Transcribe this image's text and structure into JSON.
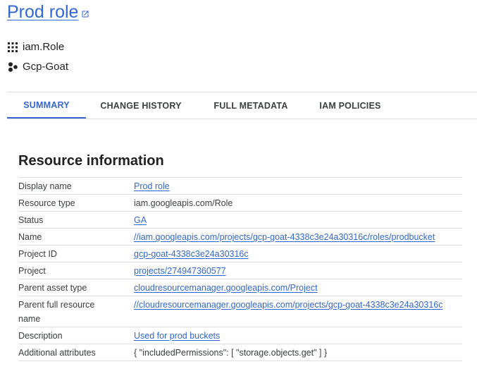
{
  "header": {
    "title": "Prod role",
    "asset_type": "iam.Role",
    "project": "Gcp-Goat"
  },
  "tabs": [
    {
      "label": "SUMMARY",
      "active": true
    },
    {
      "label": "CHANGE HISTORY",
      "active": false
    },
    {
      "label": "FULL METADATA",
      "active": false
    },
    {
      "label": "IAM POLICIES",
      "active": false
    }
  ],
  "resource_info": {
    "title": "Resource information",
    "rows": [
      {
        "key": "Display name",
        "value": "Prod role",
        "link": true
      },
      {
        "key": "Resource type",
        "value": "iam.googleapis.com/Role",
        "link": false
      },
      {
        "key": "Status",
        "value": "GA",
        "link": true
      },
      {
        "key": "Name",
        "value": "//iam.googleapis.com/projects/gcp-goat-4338c3e24a30316c/roles/prodbucket",
        "link": true
      },
      {
        "key": "Project ID",
        "value": "gcp-goat-4338c3e24a30316c",
        "link": true
      },
      {
        "key": "Project",
        "value": "projects/274947360577",
        "link": true
      },
      {
        "key": "Parent asset type",
        "value": "cloudresourcemanager.googleapis.com/Project",
        "link": true
      },
      {
        "key_line1": "Parent full resource",
        "key_line2": "name",
        "value": "//cloudresourcemanager.googleapis.com/projects/gcp-goat-4338c3e24a30316c",
        "link": true
      },
      {
        "key": "Description",
        "value": "Used for prod buckets",
        "link": true
      },
      {
        "key": "Additional attributes",
        "value": "{ \"includedPermissions\": [ \"storage.objects.get\" ] }",
        "link": false
      }
    ]
  },
  "colors": {
    "link": "#3367d6",
    "text": "#202124",
    "divider": "#e0e0e0"
  }
}
